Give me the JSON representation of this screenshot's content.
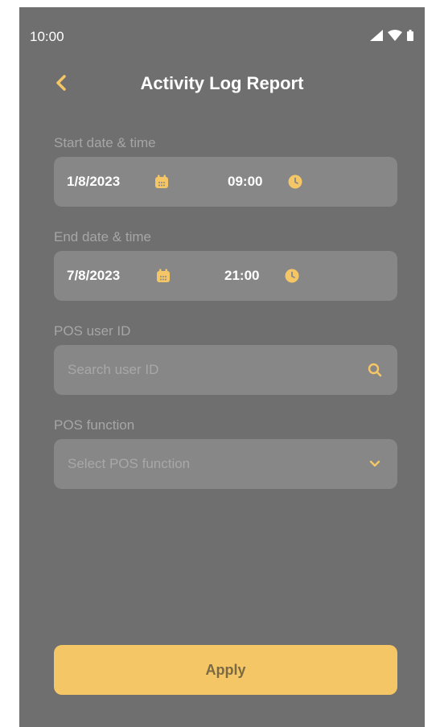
{
  "status_bar": {
    "time": "10:00",
    "icons": [
      "cellular-signal-icon",
      "wifi-icon",
      "battery-icon"
    ]
  },
  "header": {
    "title": "Activity Log Report",
    "back_icon": "chevron-left-icon"
  },
  "form": {
    "start": {
      "label": "Start date & time",
      "date": "1/8/2023",
      "time": "09:00",
      "date_icon": "calendar-icon",
      "time_icon": "clock-icon"
    },
    "end": {
      "label": "End date & time",
      "date": "7/8/2023",
      "time": "21:00",
      "date_icon": "calendar-icon",
      "time_icon": "clock-icon"
    },
    "user": {
      "label": "POS user ID",
      "placeholder": "Search user ID",
      "icon": "search-icon"
    },
    "function": {
      "label": "POS function",
      "placeholder": "Select POS function",
      "icon": "chevron-down-icon"
    }
  },
  "actions": {
    "apply_label": "Apply"
  },
  "colors": {
    "accent": "#F5C666",
    "background": "#6F6F6F",
    "field": "#878787",
    "label": "#A6A6A6",
    "placeholder": "#A8A8A8",
    "apply_text": "#7A6A43"
  }
}
